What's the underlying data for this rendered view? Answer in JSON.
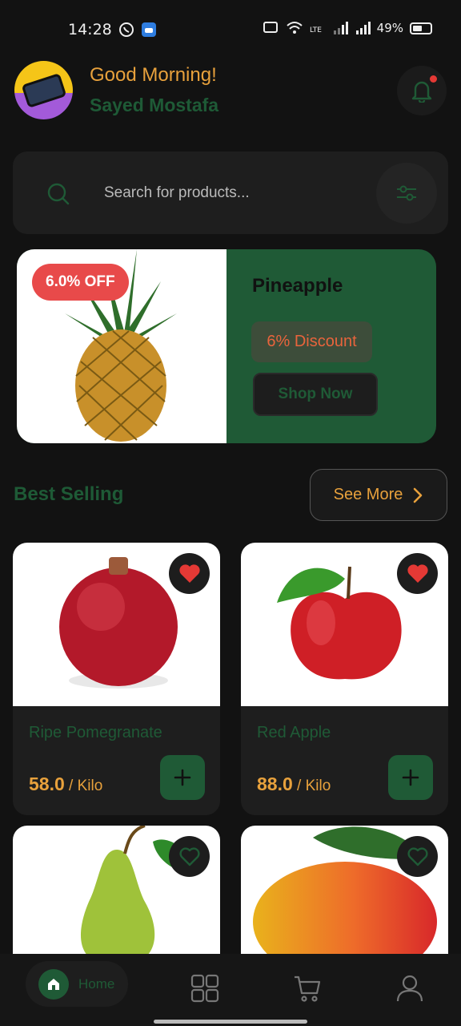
{
  "status_bar": {
    "time": "14:28",
    "battery": "49%"
  },
  "header": {
    "greeting": "Good Morning!",
    "user_name": "Sayed Mostafa"
  },
  "search": {
    "placeholder": "Search for products..."
  },
  "promo": {
    "badge": "6.0% OFF",
    "product_name": "Pineapple",
    "discount_label": "6% Discount",
    "cta": "Shop Now"
  },
  "section": {
    "title": "Best Selling",
    "see_more": "See More"
  },
  "products": [
    {
      "name": "Ripe Pomegranate",
      "price": "58.0",
      "unit": " / Kilo",
      "favorite": true
    },
    {
      "name": "Red Apple",
      "price": "88.0",
      "unit": " / Kilo",
      "favorite": true
    },
    {
      "name": "Pear",
      "favorite": false
    },
    {
      "name": "Mango",
      "favorite": false
    }
  ],
  "bottom_nav": {
    "home_label": "Home"
  },
  "colors": {
    "primary_green": "#1f5a36",
    "accent_orange": "#e8a13c",
    "sale_red": "#e84a4a",
    "background": "#121212"
  }
}
